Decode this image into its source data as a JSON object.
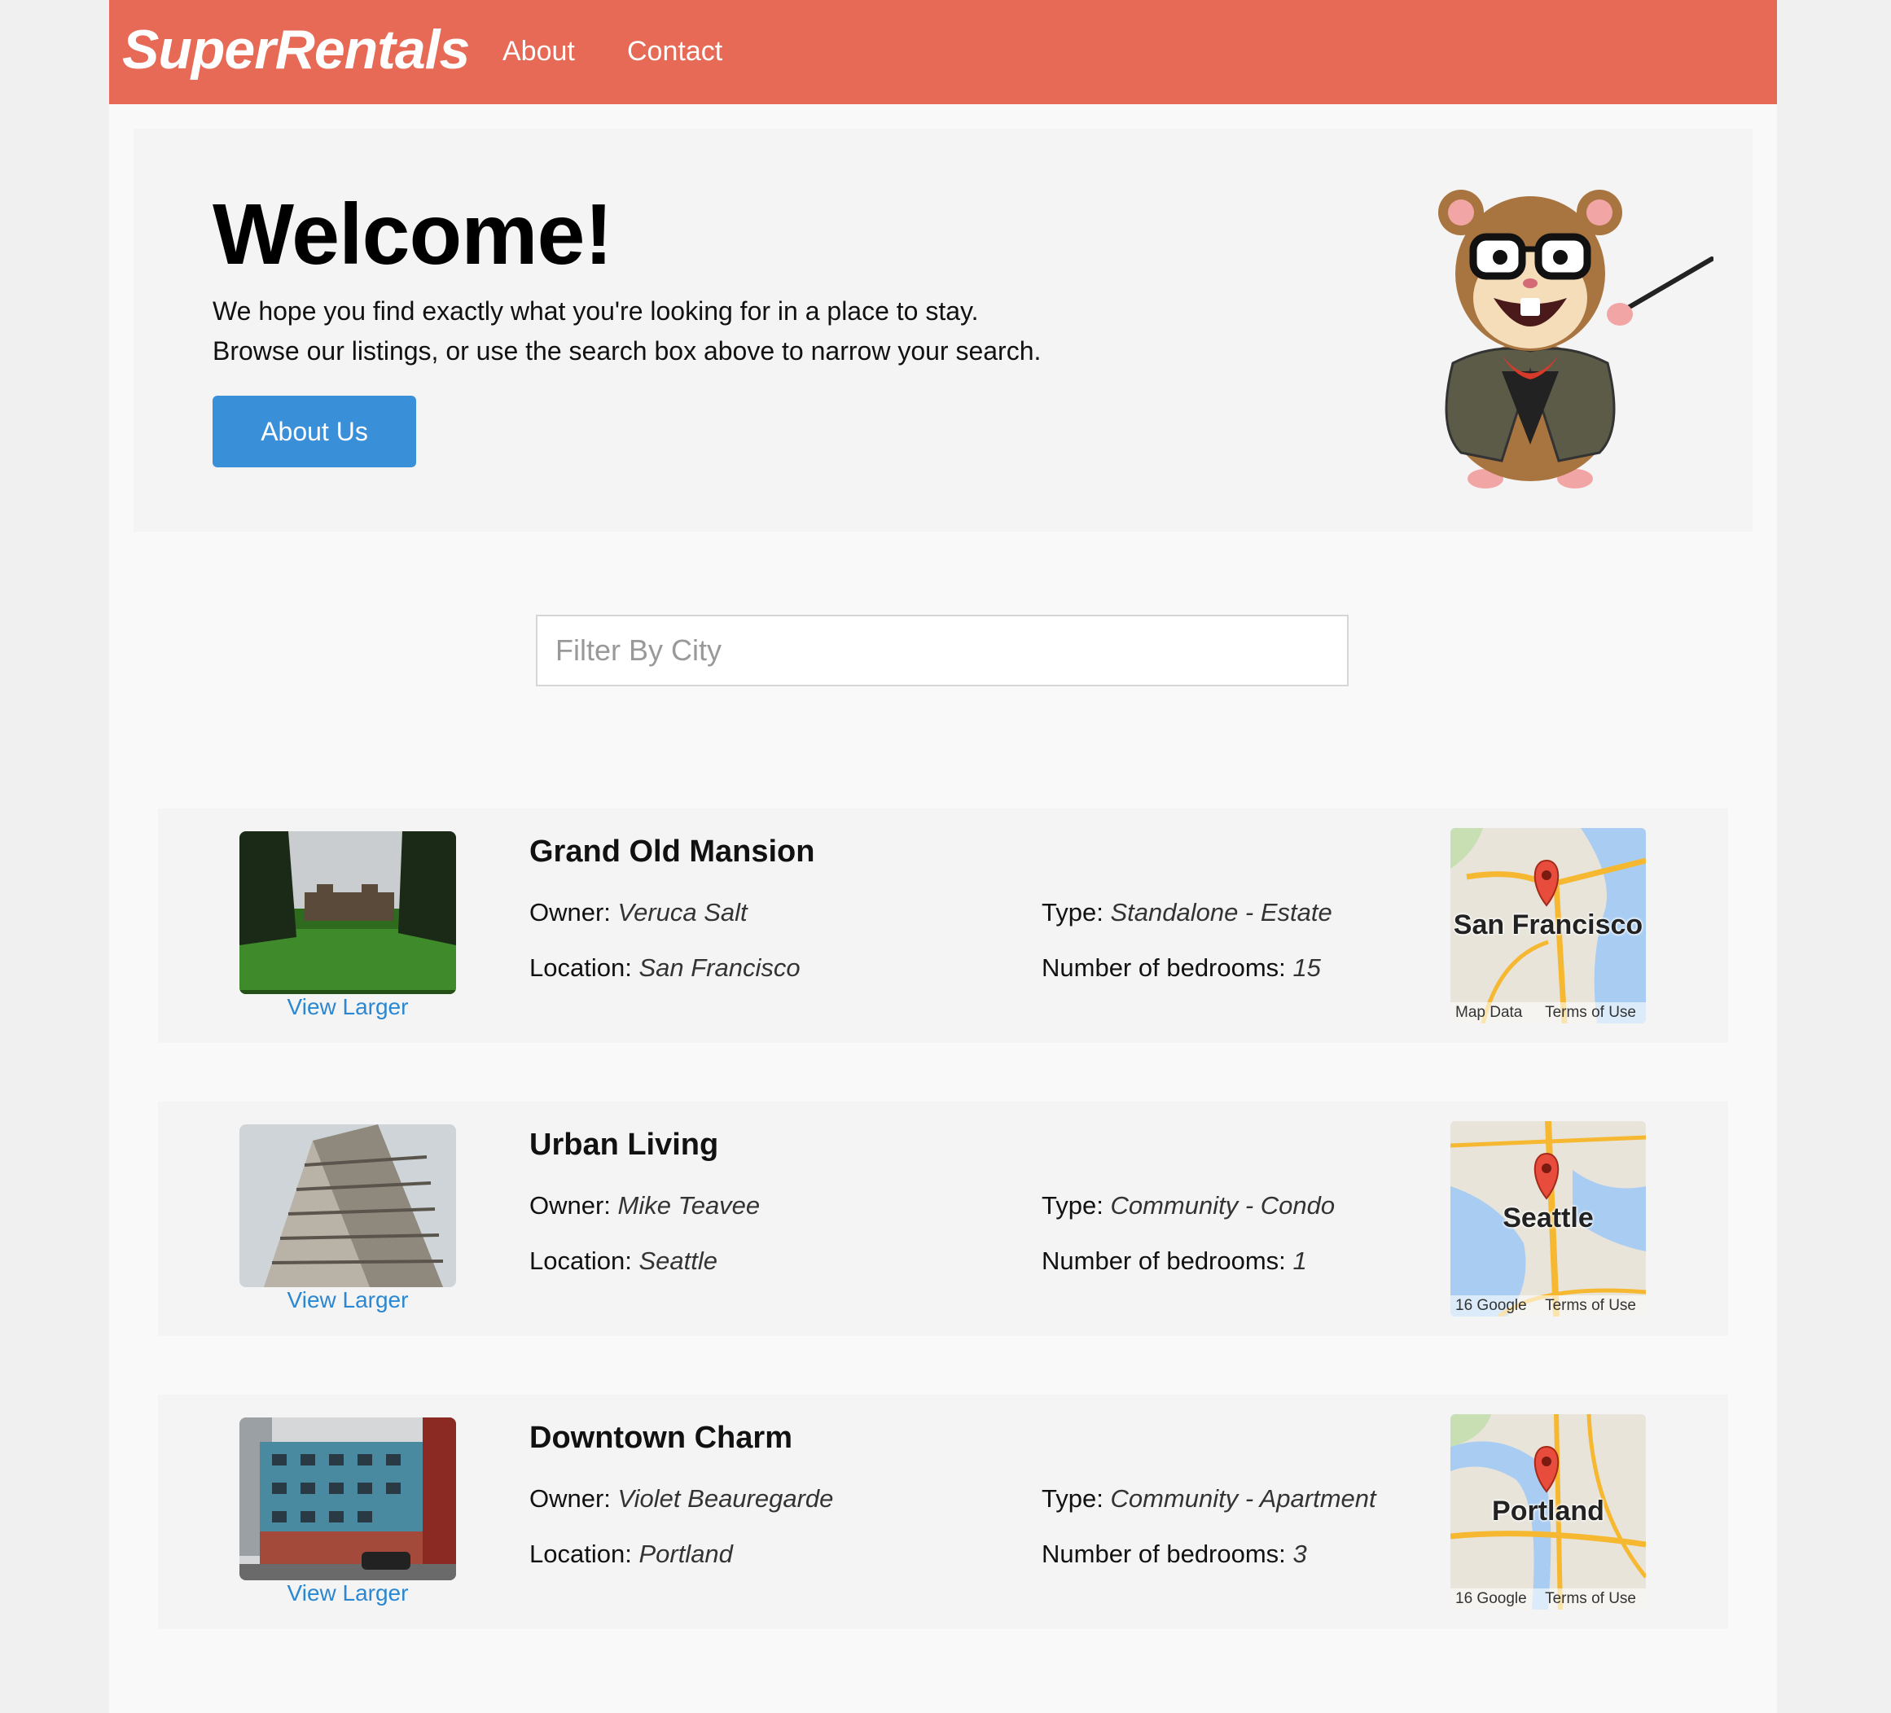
{
  "nav": {
    "brand": "SuperRentals",
    "about": "About",
    "contact": "Contact"
  },
  "jumbo": {
    "title": "Welcome!",
    "line1": "We hope you find exactly what you're looking for in a place to stay.",
    "line2": "Browse our listings, or use the search box above to narrow your search.",
    "button": "About Us"
  },
  "filter": {
    "placeholder": "Filter By City",
    "value": ""
  },
  "labels": {
    "owner": "Owner:",
    "location": "Location:",
    "type": "Type:",
    "bedrooms": "Number of bedrooms:",
    "view_larger": "View Larger"
  },
  "listings": [
    {
      "title": "Grand Old Mansion",
      "owner": "Veruca Salt",
      "location": "San Francisco",
      "type": "Standalone - Estate",
      "bedrooms": "15",
      "map_city": "San Francisco",
      "map_left": "Map Data",
      "map_right": "Terms of Use"
    },
    {
      "title": "Urban Living",
      "owner": "Mike Teavee",
      "location": "Seattle",
      "type": "Community - Condo",
      "bedrooms": "1",
      "map_city": "Seattle",
      "map_left": "16 Google",
      "map_right": "Terms of Use"
    },
    {
      "title": "Downtown Charm",
      "owner": "Violet Beauregarde",
      "location": "Portland",
      "type": "Community - Apartment",
      "bedrooms": "3",
      "map_city": "Portland",
      "map_left": "16 Google",
      "map_right": "Terms of Use"
    }
  ],
  "colors": {
    "topbar": "#e66a55",
    "button": "#3a8fd9",
    "link": "#2b87d1"
  }
}
